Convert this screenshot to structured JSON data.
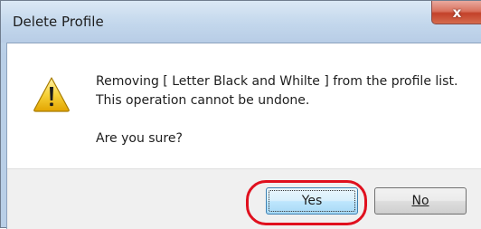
{
  "window": {
    "title": "Delete Profile",
    "close_glyph": "x"
  },
  "dialog": {
    "icon": "warning-icon",
    "message_line1": "Removing [ Letter Black and Whilte ] from the profile list.",
    "message_line2": "This operation cannot be undone.",
    "question": "Are you sure?"
  },
  "buttons": {
    "yes_label": "Yes",
    "no_label": "No"
  },
  "colors": {
    "highlight": "#e0101e",
    "close_button": "#c3412a",
    "titlebar": "#c3d7ec",
    "footer": "#f0f0f0"
  }
}
